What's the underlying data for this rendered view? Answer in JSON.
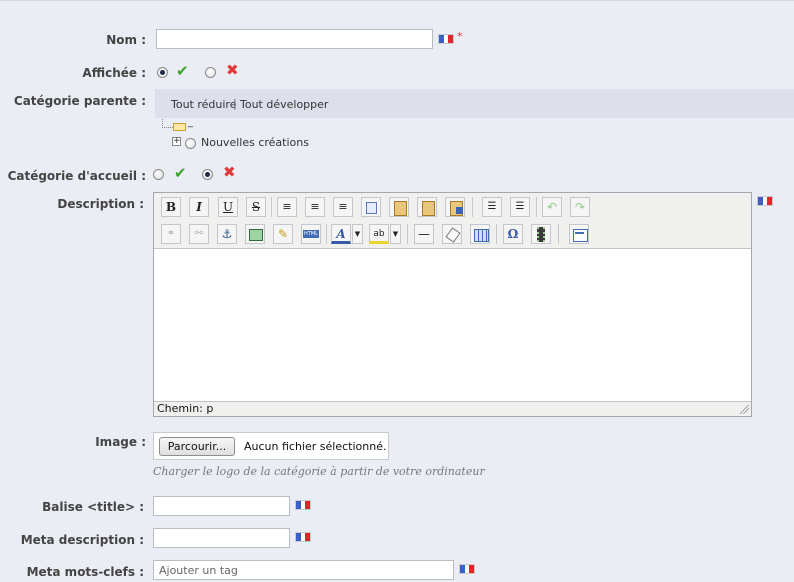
{
  "form": {
    "name_label": "Nom :",
    "required_mark": "*",
    "shown_label": "Affichée :",
    "parent_label": "Catégorie parente :",
    "collapse_all": "Tout réduire",
    "separator": "|",
    "expand_all": "Tout développer",
    "tree_root": "_",
    "tree_item": "Nouvelles créations",
    "home_label": "Catégorie d'accueil :",
    "description_label": "Description :",
    "editor_path": "Chemin: p",
    "image_label": "Image :",
    "browse_button": "Parcourir...",
    "no_file": "Aucun fichier sélectionné.",
    "image_hint": "Charger le logo de la catégorie à partir de votre ordinateur",
    "title_label": "Balise <title> :",
    "meta_description_label": "Meta description :",
    "meta_keywords_label": "Meta mots-clefs :",
    "keywords_placeholder": "Ajouter un tag"
  },
  "toggles": {
    "shown_yes_selected": true,
    "home_no_selected": true
  },
  "colors": {
    "background": "#ebedf4",
    "yes_check": "#39a32b",
    "no_cross": "#e23a3a"
  },
  "icons": {
    "language_flag": "french-flag-icon",
    "yes": "checkmark-icon",
    "no": "cross-icon"
  },
  "toolbar": {
    "bold": "B",
    "italic": "I",
    "underline": "U",
    "strike": "S",
    "html": "HTML",
    "font_color": "A",
    "highlight": "ab",
    "omega": "Ω",
    "horizontal_rule": "—"
  }
}
